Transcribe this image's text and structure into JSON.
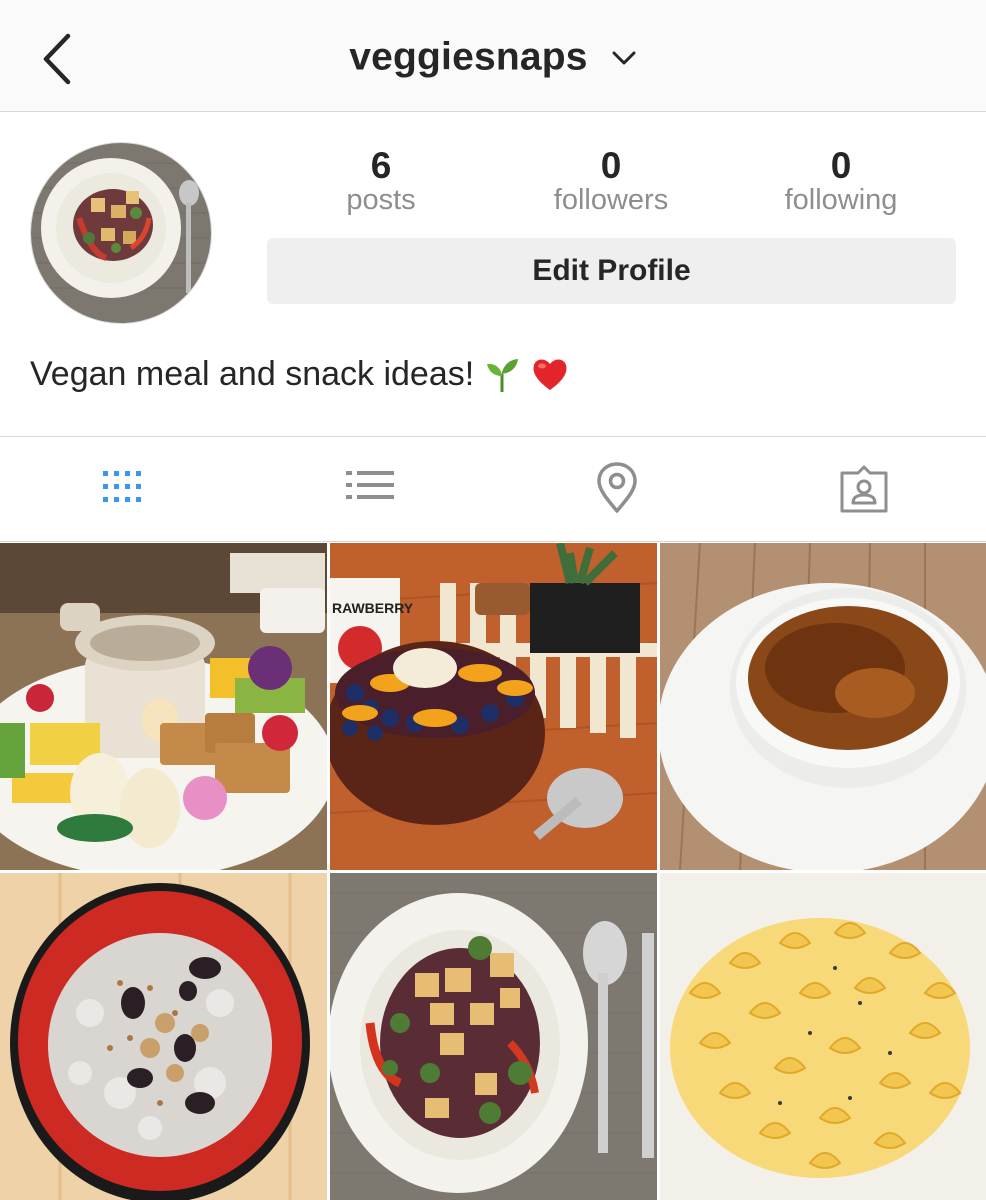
{
  "header": {
    "username": "veggiesnaps",
    "back_icon": "chevron-left-icon",
    "dropdown_icon": "chevron-down-icon"
  },
  "profile": {
    "stats": [
      {
        "value": "6",
        "label": "posts"
      },
      {
        "value": "0",
        "label": "followers"
      },
      {
        "value": "0",
        "label": "following"
      }
    ],
    "edit_label": "Edit Profile",
    "bio": "Vegan meal and snack ideas!",
    "bio_emoji": [
      "seedling-emoji",
      "red-heart-emoji"
    ]
  },
  "tabs": [
    {
      "icon": "grid-icon",
      "active": true
    },
    {
      "icon": "list-icon",
      "active": false
    },
    {
      "icon": "location-pin-icon",
      "active": false
    },
    {
      "icon": "tagged-person-icon",
      "active": false
    }
  ],
  "colors": {
    "accent": "#3897f0",
    "icon_gray": "#8e8e8e",
    "text": "#262626",
    "button_bg": "#efefef"
  },
  "posts": [
    {
      "subject": "fondue-fruit-waffle-plate"
    },
    {
      "subject": "acai-bowl",
      "mug_text": "RAWBERRY"
    },
    {
      "subject": "creme-brulee"
    },
    {
      "subject": "oatmeal-bowl"
    },
    {
      "subject": "tofu-stir-fry"
    },
    {
      "subject": "mac-and-cheese"
    }
  ]
}
